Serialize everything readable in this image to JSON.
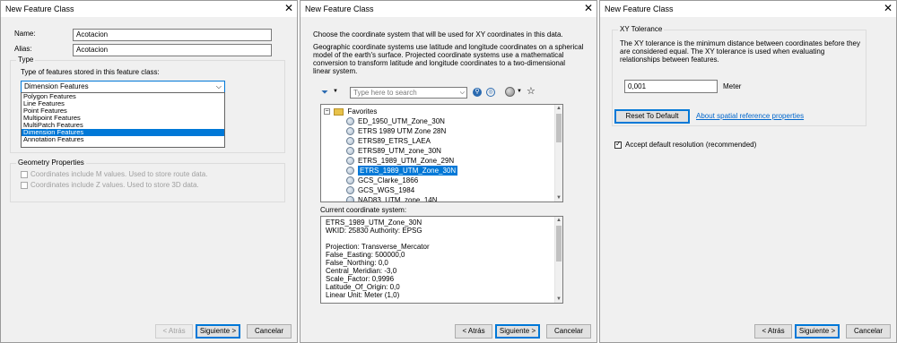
{
  "dialog1": {
    "title": "New Feature Class",
    "name_label": "Name:",
    "name_value": "Acotacion",
    "alias_label": "Alias:",
    "alias_value": "Acotacion",
    "type_group": "Type",
    "type_desc": "Type of features stored in this feature class:",
    "type_selected": "Dimension Features",
    "type_options": [
      "Polygon Features",
      "Line Features",
      "Point Features",
      "Multipoint Features",
      "MultiPatch Features",
      "Dimension Features",
      "Annotation Features"
    ],
    "geometry_group": "Geometry Properties",
    "m_values": "Coordinates include M values. Used to store route data.",
    "z_values": "Coordinates include Z values. Used to store 3D data.",
    "back": "< Atrás",
    "next": "Siguiente >",
    "cancel": "Cancelar"
  },
  "dialog2": {
    "title": "New Feature Class",
    "intro": "Choose the coordinate system that will be used for XY coordinates in this data.",
    "desc": "Geographic coordinate systems use latitude and longitude coordinates on a spherical model of the earth's surface. Projected coordinate systems use a mathematical conversion to transform latitude and longitude coordinates to a two-dimensional linear system.",
    "search_placeholder": "Type here to search",
    "favorites": "Favorites",
    "tree_items": [
      "ED_1950_UTM_Zone_30N",
      "ETRS 1989 UTM Zone 28N",
      "ETRS89_ETRS_LAEA",
      "ETRS89_UTM_zone_30N",
      "ETRS_1989_UTM_Zone_29N",
      "ETRS_1989_UTM_Zone_30N",
      "GCS_Clarke_1866",
      "GCS_WGS_1984",
      "NAD83_UTM_zone_14N"
    ],
    "current_label": "Current coordinate system:",
    "current_lines": [
      "ETRS_1989_UTM_Zone_30N",
      "WKID: 25830 Authority: EPSG",
      "",
      "Projection: Transverse_Mercator",
      "False_Easting: 500000,0",
      "False_Northing: 0,0",
      "Central_Meridian: -3,0",
      "Scale_Factor: 0,9996",
      "Latitude_Of_Origin: 0,0",
      "Linear Unit: Meter (1,0)"
    ],
    "back": "< Atrás",
    "next": "Siguiente >",
    "cancel": "Cancelar"
  },
  "dialog3": {
    "title": "New Feature Class",
    "group": "XY Tolerance",
    "desc": "The XY tolerance is the minimum distance between coordinates before they are considered equal. The XY tolerance is used when evaluating relationships between features.",
    "tolerance_value": "0,001",
    "unit": "Meter",
    "reset": "Reset To Default",
    "about_link": "About spatial reference properties",
    "accept_default": "Accept default resolution  (recommended)",
    "back": "< Atrás",
    "next": "Siguiente >",
    "cancel": "Cancelar"
  }
}
